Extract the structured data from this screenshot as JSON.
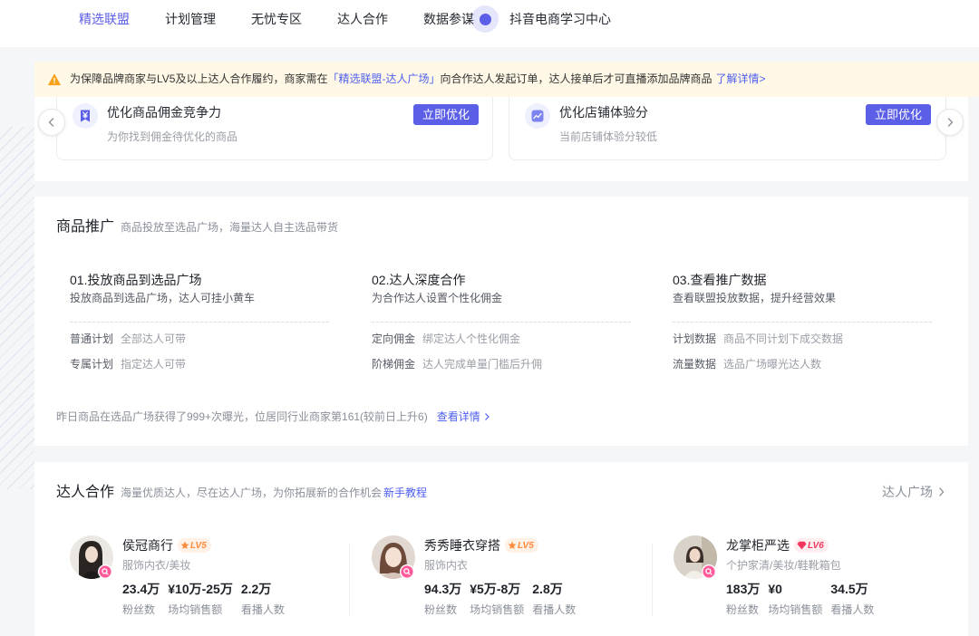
{
  "theme": {
    "primary": "#5b5ee6",
    "link": "#4e5ff0",
    "notice_background": "#fff8e6",
    "warning": "#f7a21b",
    "level_orange": "#ff8b3d",
    "level_red": "#f5365c"
  },
  "nav": {
    "items": [
      {
        "label": "精选联盟",
        "active": true
      },
      {
        "label": "计划管理",
        "active": false
      },
      {
        "label": "无忧专区",
        "active": false
      },
      {
        "label": "达人合作",
        "active": false
      },
      {
        "label": "数据参谋",
        "active": false
      },
      {
        "label": "抖音电商学习中心",
        "active": false
      }
    ],
    "guide_icon": "guide-dot-icon"
  },
  "notice": {
    "icon": "warning-icon",
    "text_before": "为保障品牌商家与LV5及以上达人合作履约，商家需在",
    "highlight": "「精选联盟-达人广场」",
    "text_after": "向合作达人发起订单，达人接单后才可直播添加品牌商品",
    "more_link": "了解详情>"
  },
  "suggestions": {
    "prev_icon": "chevron-left-icon",
    "next_icon": "chevron-right-icon",
    "cards": [
      {
        "icon": "commission-bookmark-icon",
        "title": "优化商品佣金竞争力",
        "desc": "为你找到佣金待优化的商品",
        "button": "立即优化"
      },
      {
        "icon": "score-chart-icon",
        "title": "优化店铺体验分",
        "desc": "当前店铺体验分较低",
        "button": "立即优化"
      }
    ]
  },
  "promotion": {
    "title": "商品推广",
    "subtitle": "商品投放至选品广场，海量达人自主选品带货",
    "steps": [
      {
        "title": "01.投放商品到选品广场",
        "desc": "投放商品到选品广场，达人可挂小黄车",
        "rows": [
          {
            "label": "普通计划",
            "value": "全部达人可带"
          },
          {
            "label": "专属计划",
            "value": "指定达人可带"
          }
        ]
      },
      {
        "title": "02.达人深度合作",
        "desc": "为合作达人设置个性化佣金",
        "rows": [
          {
            "label": "定向佣金",
            "value": "绑定达人个性化佣金"
          },
          {
            "label": "阶梯佣金",
            "value": "达人完成单量门槛后升佣"
          }
        ]
      },
      {
        "title": "03.查看推广数据",
        "desc": "查看联盟投放数据，提升经营效果",
        "rows": [
          {
            "label": "计划数据",
            "value": "商品不同计划下成交数据"
          },
          {
            "label": "流量数据",
            "value": "选品广场曝光达人数"
          }
        ]
      }
    ],
    "summary": "昨日商品在选品广场获得了999+次曝光，位居同行业商家第161(较前日上升6)",
    "summary_link": "查看详情"
  },
  "cooperation": {
    "title": "达人合作",
    "subtitle": "海量优质达人，尽在达人广场，为你拓展新的合作机会",
    "tutorial_link": "新手教程",
    "more_link": "达人广场",
    "influencers": [
      {
        "name": "侯冠商行",
        "level": "LV5",
        "level_icon": "star-icon",
        "category": "服饰内衣/美妆",
        "stats": [
          {
            "value": "23.4万",
            "label": "粉丝数"
          },
          {
            "value": "¥10万-25万",
            "label": "场均销售额"
          },
          {
            "value": "2.2万",
            "label": "看播人数"
          }
        ]
      },
      {
        "name": "秀秀睡衣穿搭",
        "level": "LV5",
        "level_icon": "star-icon",
        "category": "服饰内衣",
        "stats": [
          {
            "value": "94.3万",
            "label": "粉丝数"
          },
          {
            "value": "¥5万-8万",
            "label": "场均销售额"
          },
          {
            "value": "2.8万",
            "label": "看播人数"
          }
        ]
      },
      {
        "name": "龙掌柜严选",
        "level": "LV6",
        "level_icon": "diamond-icon",
        "category": "个护家清/美妆/鞋靴箱包",
        "stats": [
          {
            "value": "183万",
            "label": "粉丝数"
          },
          {
            "value": "¥0",
            "label": "场均销售额"
          },
          {
            "value": "34.5万",
            "label": "看播人数"
          }
        ]
      }
    ]
  }
}
